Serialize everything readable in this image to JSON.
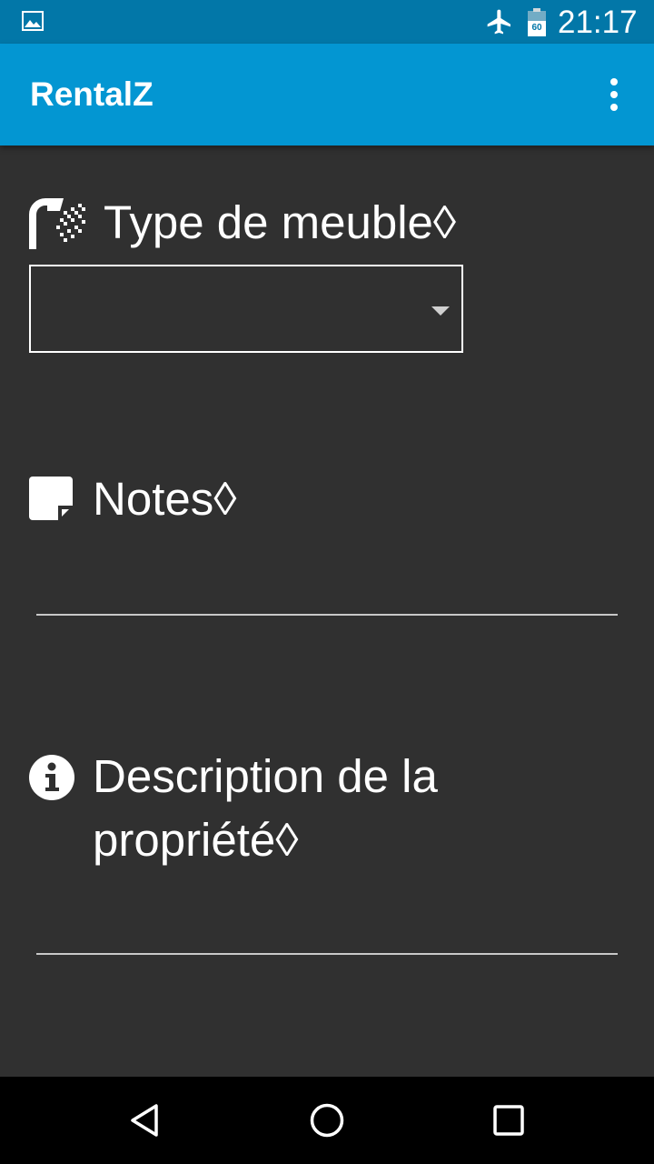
{
  "status_bar": {
    "time": "21:17",
    "icons": [
      "image-notification-icon",
      "airplane-mode-icon",
      "battery-icon"
    ],
    "battery_label": "60"
  },
  "app_bar": {
    "title": "RentalZ",
    "menu_icon": "overflow-menu-icon"
  },
  "form": {
    "furniture": {
      "label": "Type de meuble◊",
      "icon": "shower-icon",
      "selected_value": ""
    },
    "notes": {
      "label": "Notes◊",
      "icon": "sticky-note-icon",
      "value": ""
    },
    "description": {
      "label_line1": "Description de la",
      "label_line2": "propriété◊",
      "icon": "info-icon",
      "value": ""
    }
  },
  "nav_bar": {
    "buttons": [
      "back-icon",
      "home-icon",
      "recents-icon"
    ]
  },
  "colors": {
    "status_bar": "#0277a8",
    "app_bar": "#0396d2",
    "background": "#303030",
    "nav_bar": "#000000"
  }
}
